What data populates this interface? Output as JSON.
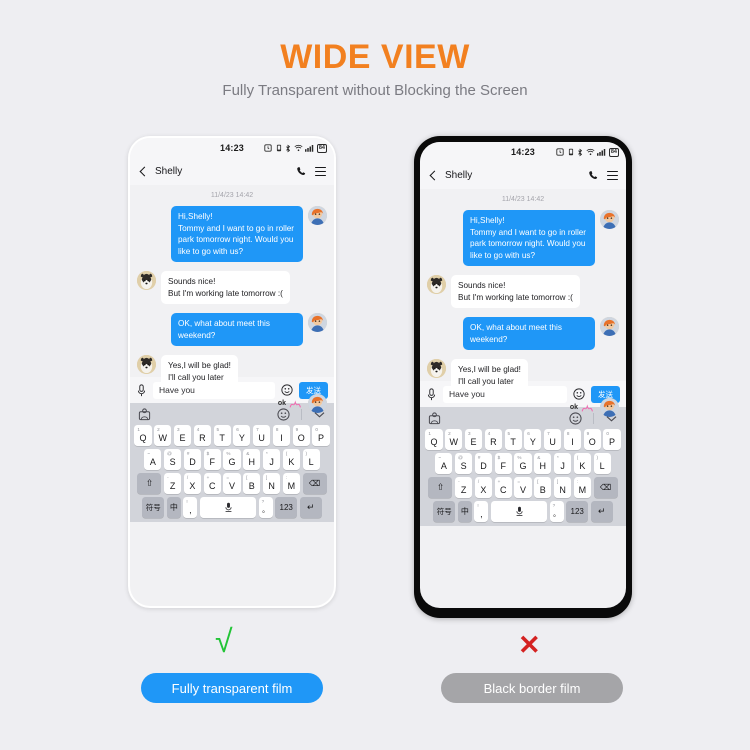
{
  "header": {
    "title": "WIDE VIEW",
    "subtitle": "Fully Transparent without Blocking the Screen"
  },
  "phone": {
    "status": {
      "time": "14:23",
      "battery_level": "84",
      "icons": [
        "alarm-icon",
        "vibrate-icon",
        "bluetooth-icon",
        "wifi-icon",
        "signal-icon",
        "battery-icon"
      ]
    },
    "chat_header": {
      "back_label": "back-arrow",
      "peer_name": "Shelly",
      "call_icon": "phone-icon",
      "menu_icon": "hamburger-icon"
    },
    "conversation": {
      "timestamp": "11/4/23 14:42",
      "messages": [
        {
          "side": "out",
          "text": "Hi,Shelly!\nTommy and I want to go in roller park tomorrow night. Would you like to go with us?"
        },
        {
          "side": "in",
          "text": "Sounds nice!\nBut I'm working late tomorrow :("
        },
        {
          "side": "out",
          "text": "OK, what about meet this weekend?"
        },
        {
          "side": "in",
          "text": "Yes,I will be glad!\nI'll call you later"
        }
      ],
      "sticker_text": "ok"
    },
    "input": {
      "mic_icon": "microphone-icon",
      "text_value": "Have you",
      "emoji_icon": "emoji-icon",
      "send_label": "发送"
    },
    "keyboard": {
      "tools": {
        "sticker_icon": "sticker-icon",
        "emoji_icon": "emoji-icon",
        "collapse_icon": "chevron-down-icon"
      },
      "row1": [
        {
          "key": "Q",
          "sup": "1"
        },
        {
          "key": "W",
          "sup": "2"
        },
        {
          "key": "E",
          "sup": "3"
        },
        {
          "key": "R",
          "sup": "4"
        },
        {
          "key": "T",
          "sup": "5"
        },
        {
          "key": "Y",
          "sup": "6"
        },
        {
          "key": "U",
          "sup": "7"
        },
        {
          "key": "I",
          "sup": "8"
        },
        {
          "key": "O",
          "sup": "9"
        },
        {
          "key": "P",
          "sup": "0"
        }
      ],
      "row2": [
        {
          "key": "A",
          "sup": "~"
        },
        {
          "key": "S",
          "sup": "@"
        },
        {
          "key": "D",
          "sup": "#"
        },
        {
          "key": "F",
          "sup": "$"
        },
        {
          "key": "G",
          "sup": "%"
        },
        {
          "key": "H",
          "sup": "&"
        },
        {
          "key": "J",
          "sup": "*"
        },
        {
          "key": "K",
          "sup": "("
        },
        {
          "key": "L",
          "sup": ")"
        }
      ],
      "row3": [
        {
          "key": "Z",
          "sup": "-"
        },
        {
          "key": "X",
          "sup": "/"
        },
        {
          "key": "C",
          "sup": "+"
        },
        {
          "key": "V",
          "sup": "="
        },
        {
          "key": "B",
          "sup": "["
        },
        {
          "key": "N",
          "sup": "]"
        },
        {
          "key": "M",
          "sup": ":"
        }
      ],
      "shift_label": "⇧",
      "backspace_label": "⌫",
      "row4": {
        "symbols_label": "符号",
        "lang_label": "中",
        "comma_key": ",",
        "comma_sup": "!",
        "space_icon": "microphone-icon",
        "period_key": "。",
        "period_sup": "?",
        "numeric_label": "123",
        "enter_label": "↵"
      }
    }
  },
  "comparison": {
    "left": {
      "mark": "√",
      "label": "Fully transparent film"
    },
    "right": {
      "mark": "✕",
      "label": "Black border film"
    }
  },
  "colors": {
    "accent_orange": "#f28020",
    "bubble_blue": "#1f97f7",
    "check_green": "#22c437",
    "cross_red": "#d42222",
    "gray_pill": "#a5a5a8",
    "page_bg": "#eeeef2"
  }
}
